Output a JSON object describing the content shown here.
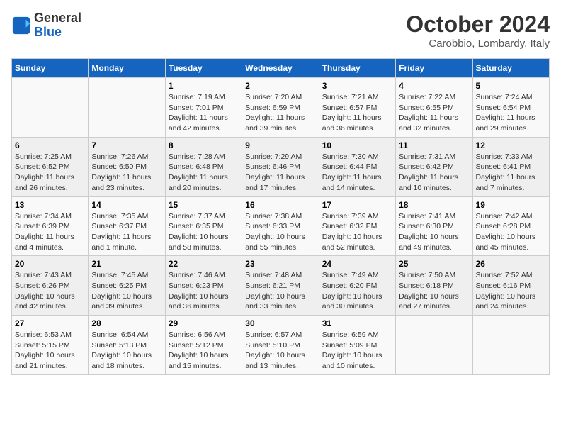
{
  "logo": {
    "line1": "General",
    "line2": "Blue"
  },
  "title": "October 2024",
  "location": "Carobbio, Lombardy, Italy",
  "weekdays": [
    "Sunday",
    "Monday",
    "Tuesday",
    "Wednesday",
    "Thursday",
    "Friday",
    "Saturday"
  ],
  "weeks": [
    [
      {
        "day": "",
        "text": ""
      },
      {
        "day": "",
        "text": ""
      },
      {
        "day": "1",
        "text": "Sunrise: 7:19 AM\nSunset: 7:01 PM\nDaylight: 11 hours and 42 minutes."
      },
      {
        "day": "2",
        "text": "Sunrise: 7:20 AM\nSunset: 6:59 PM\nDaylight: 11 hours and 39 minutes."
      },
      {
        "day": "3",
        "text": "Sunrise: 7:21 AM\nSunset: 6:57 PM\nDaylight: 11 hours and 36 minutes."
      },
      {
        "day": "4",
        "text": "Sunrise: 7:22 AM\nSunset: 6:55 PM\nDaylight: 11 hours and 32 minutes."
      },
      {
        "day": "5",
        "text": "Sunrise: 7:24 AM\nSunset: 6:54 PM\nDaylight: 11 hours and 29 minutes."
      }
    ],
    [
      {
        "day": "6",
        "text": "Sunrise: 7:25 AM\nSunset: 6:52 PM\nDaylight: 11 hours and 26 minutes."
      },
      {
        "day": "7",
        "text": "Sunrise: 7:26 AM\nSunset: 6:50 PM\nDaylight: 11 hours and 23 minutes."
      },
      {
        "day": "8",
        "text": "Sunrise: 7:28 AM\nSunset: 6:48 PM\nDaylight: 11 hours and 20 minutes."
      },
      {
        "day": "9",
        "text": "Sunrise: 7:29 AM\nSunset: 6:46 PM\nDaylight: 11 hours and 17 minutes."
      },
      {
        "day": "10",
        "text": "Sunrise: 7:30 AM\nSunset: 6:44 PM\nDaylight: 11 hours and 14 minutes."
      },
      {
        "day": "11",
        "text": "Sunrise: 7:31 AM\nSunset: 6:42 PM\nDaylight: 11 hours and 10 minutes."
      },
      {
        "day": "12",
        "text": "Sunrise: 7:33 AM\nSunset: 6:41 PM\nDaylight: 11 hours and 7 minutes."
      }
    ],
    [
      {
        "day": "13",
        "text": "Sunrise: 7:34 AM\nSunset: 6:39 PM\nDaylight: 11 hours and 4 minutes."
      },
      {
        "day": "14",
        "text": "Sunrise: 7:35 AM\nSunset: 6:37 PM\nDaylight: 11 hours and 1 minute."
      },
      {
        "day": "15",
        "text": "Sunrise: 7:37 AM\nSunset: 6:35 PM\nDaylight: 10 hours and 58 minutes."
      },
      {
        "day": "16",
        "text": "Sunrise: 7:38 AM\nSunset: 6:33 PM\nDaylight: 10 hours and 55 minutes."
      },
      {
        "day": "17",
        "text": "Sunrise: 7:39 AM\nSunset: 6:32 PM\nDaylight: 10 hours and 52 minutes."
      },
      {
        "day": "18",
        "text": "Sunrise: 7:41 AM\nSunset: 6:30 PM\nDaylight: 10 hours and 49 minutes."
      },
      {
        "day": "19",
        "text": "Sunrise: 7:42 AM\nSunset: 6:28 PM\nDaylight: 10 hours and 45 minutes."
      }
    ],
    [
      {
        "day": "20",
        "text": "Sunrise: 7:43 AM\nSunset: 6:26 PM\nDaylight: 10 hours and 42 minutes."
      },
      {
        "day": "21",
        "text": "Sunrise: 7:45 AM\nSunset: 6:25 PM\nDaylight: 10 hours and 39 minutes."
      },
      {
        "day": "22",
        "text": "Sunrise: 7:46 AM\nSunset: 6:23 PM\nDaylight: 10 hours and 36 minutes."
      },
      {
        "day": "23",
        "text": "Sunrise: 7:48 AM\nSunset: 6:21 PM\nDaylight: 10 hours and 33 minutes."
      },
      {
        "day": "24",
        "text": "Sunrise: 7:49 AM\nSunset: 6:20 PM\nDaylight: 10 hours and 30 minutes."
      },
      {
        "day": "25",
        "text": "Sunrise: 7:50 AM\nSunset: 6:18 PM\nDaylight: 10 hours and 27 minutes."
      },
      {
        "day": "26",
        "text": "Sunrise: 7:52 AM\nSunset: 6:16 PM\nDaylight: 10 hours and 24 minutes."
      }
    ],
    [
      {
        "day": "27",
        "text": "Sunrise: 6:53 AM\nSunset: 5:15 PM\nDaylight: 10 hours and 21 minutes."
      },
      {
        "day": "28",
        "text": "Sunrise: 6:54 AM\nSunset: 5:13 PM\nDaylight: 10 hours and 18 minutes."
      },
      {
        "day": "29",
        "text": "Sunrise: 6:56 AM\nSunset: 5:12 PM\nDaylight: 10 hours and 15 minutes."
      },
      {
        "day": "30",
        "text": "Sunrise: 6:57 AM\nSunset: 5:10 PM\nDaylight: 10 hours and 13 minutes."
      },
      {
        "day": "31",
        "text": "Sunrise: 6:59 AM\nSunset: 5:09 PM\nDaylight: 10 hours and 10 minutes."
      },
      {
        "day": "",
        "text": ""
      },
      {
        "day": "",
        "text": ""
      }
    ]
  ]
}
